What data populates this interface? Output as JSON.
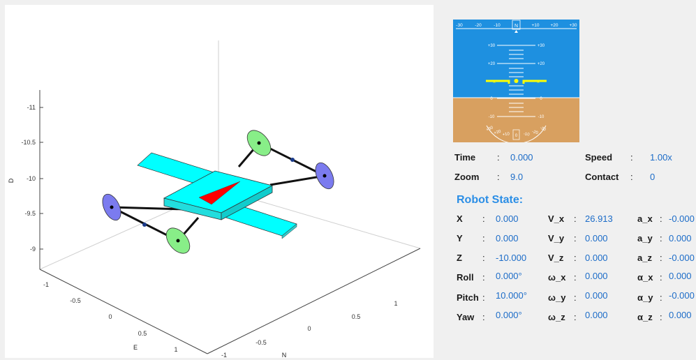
{
  "plot": {
    "d_axis": {
      "label": "D",
      "ticks": [
        "-11",
        "-10.5",
        "-10",
        "-9.5",
        "-9"
      ]
    },
    "e_axis": {
      "label": "E",
      "ticks": [
        "-1",
        "-0.5",
        "0",
        "0.5",
        "1"
      ]
    },
    "n_axis": {
      "label": "N",
      "ticks": [
        "-1",
        "-0.5",
        "0",
        "0.5",
        "1"
      ]
    },
    "colors": {
      "body": "#00ffff",
      "nose_marker": "#ff0000",
      "front_rotor": "#6666ee",
      "rear_rotor": "#66ee66",
      "arm": "#000000"
    }
  },
  "attitude_indicator": {
    "heading_scale": [
      "-30",
      "-20",
      "-10",
      "N",
      "+10",
      "+20",
      "+30"
    ],
    "pitch_ladder_left": [
      "+30",
      "+20",
      "0",
      "-10"
    ],
    "pitch_ladder_right": [
      "+30",
      "+20",
      "0",
      "-10"
    ],
    "roll_arc": [
      "+30",
      "+20",
      "+10",
      "0",
      "-10",
      "-20",
      "-30"
    ],
    "colors": {
      "sky": "#1e90e0",
      "ground": "#d8a060",
      "reference": "#ffff00"
    }
  },
  "info": {
    "time": {
      "label": "Time",
      "value": "0.000"
    },
    "speed": {
      "label": "Speed",
      "value": "1.00x"
    },
    "zoom": {
      "label": "Zoom",
      "value": "9.0"
    },
    "contact": {
      "label": "Contact",
      "value": "0"
    }
  },
  "robot_state": {
    "title": "Robot State:",
    "col1": [
      {
        "label": "X",
        "value": "0.000"
      },
      {
        "label": "Y",
        "value": "0.000"
      },
      {
        "label": "Z",
        "value": "-10.000"
      },
      {
        "label": "Roll",
        "value": "0.000°"
      },
      {
        "label": "Pitch",
        "value": "10.000°"
      },
      {
        "label": "Yaw",
        "value": "0.000°"
      }
    ],
    "col2": [
      {
        "label": "V_x",
        "value": "26.913"
      },
      {
        "label": "V_y",
        "value": "0.000"
      },
      {
        "label": "V_z",
        "value": "0.000"
      },
      {
        "label": "ω_x",
        "value": "0.000"
      },
      {
        "label": "ω_y",
        "value": "0.000"
      },
      {
        "label": "ω_z",
        "value": "0.000"
      }
    ],
    "col3": [
      {
        "label": "a_x",
        "value": "-0.000"
      },
      {
        "label": "a_y",
        "value": "0.000"
      },
      {
        "label": "a_z",
        "value": "-0.000"
      },
      {
        "label": "α_x",
        "value": "0.000"
      },
      {
        "label": "α_y",
        "value": "-0.000"
      },
      {
        "label": "α_z",
        "value": "0.000"
      }
    ]
  }
}
